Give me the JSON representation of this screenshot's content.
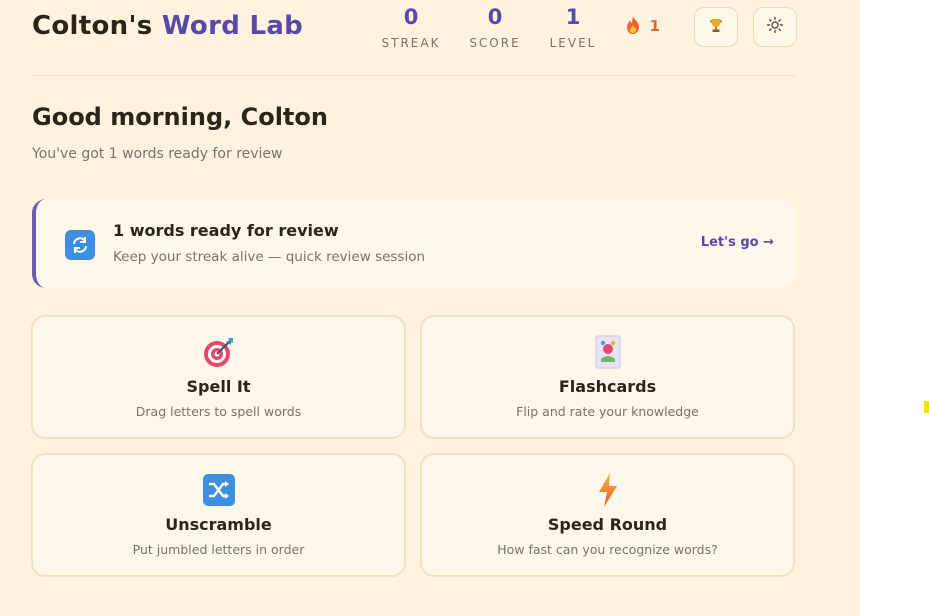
{
  "header": {
    "brand_owner": "Colton's",
    "brand_name": "Word Lab",
    "stats": {
      "streak": {
        "value": "0",
        "label": "STREAK"
      },
      "score": {
        "value": "0",
        "label": "SCORE"
      },
      "level": {
        "value": "1",
        "label": "LEVEL"
      }
    },
    "flame_count": "1",
    "icons": {
      "flame": "flame-icon",
      "trophy": "trophy-icon",
      "settings": "sun-gear-icon"
    }
  },
  "greeting": {
    "title": "Good morning, Colton",
    "subtitle": "You've got 1 words ready for review"
  },
  "review": {
    "title": "1 words ready for review",
    "subtitle": "Keep your streak alive — quick review session",
    "cta": "Let's go →",
    "icon": "refresh-arrows-icon"
  },
  "modes": [
    {
      "title": "Spell It",
      "description": "Drag letters to spell words",
      "icon": "target-icon"
    },
    {
      "title": "Flashcards",
      "description": "Flip and rate your knowledge",
      "icon": "card-icon"
    },
    {
      "title": "Unscramble",
      "description": "Put jumbled letters in order",
      "icon": "shuffle-icon"
    },
    {
      "title": "Speed Round",
      "description": "How fast can you recognize words?",
      "icon": "lightning-icon"
    }
  ],
  "colors": {
    "accent": "#5a48a8",
    "background": "#fdf3df",
    "card": "#fff7ea",
    "flame": "#d86a3a"
  }
}
